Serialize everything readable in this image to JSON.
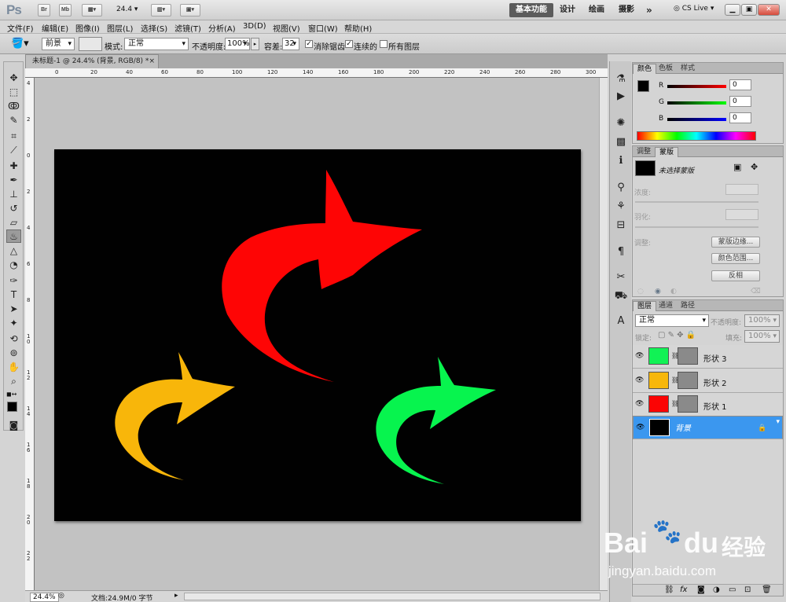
{
  "appbar": {
    "logo": "Ps",
    "btn_bridge": "Br",
    "btn_minibridge": "Mb",
    "zoom": "24.4",
    "workspaces": [
      "基本功能",
      "设计",
      "绘画",
      "摄影"
    ],
    "more": "»",
    "cslive": "CS Live"
  },
  "menu": [
    "文件(F)",
    "编辑(E)",
    "图像(I)",
    "图层(L)",
    "选择(S)",
    "滤镜(T)",
    "分析(A)",
    "3D(D)",
    "视图(V)",
    "窗口(W)",
    "帮助(H)"
  ],
  "options": {
    "fill_source": "前景",
    "mode_label": "模式:",
    "mode_value": "正常",
    "opacity_label": "不透明度:",
    "opacity_value": "100%",
    "tolerance_label": "容差:",
    "tolerance_value": "32",
    "antialias_label": "消除锯齿",
    "contiguous_label": "连续的",
    "alllayers_label": "所有图层"
  },
  "document": {
    "tab_title": "未标题-1 @ 24.4% (背景, RGB/8) *",
    "close": "×",
    "hruler": [
      "0",
      "20",
      "40",
      "60",
      "80",
      "100",
      "120",
      "140",
      "160",
      "180",
      "200",
      "220",
      "240",
      "260",
      "280",
      "300"
    ],
    "vruler": [
      "4",
      "2",
      "0",
      "2",
      "4",
      "6",
      "8",
      "1 0",
      "1 2",
      "1 4",
      "1 6",
      "1 8",
      "2 0",
      "2 2"
    ],
    "status_zoom": "24.4%",
    "status_doc": "文档:24.9M/0 字节"
  },
  "color_panel": {
    "tabs": [
      "颜色",
      "色板",
      "样式"
    ],
    "r_label": "R",
    "g_label": "G",
    "b_label": "B",
    "r": "0",
    "g": "0",
    "b": "0"
  },
  "masks_panel": {
    "tabs": [
      "调整",
      "蒙版"
    ],
    "no_mask": "未选择蒙版",
    "density_label": "浓度:",
    "feather_label": "羽化:",
    "refine_label": "调整:",
    "btn_edge": "蒙版边缘...",
    "btn_range": "颜色范围...",
    "btn_invert": "反相"
  },
  "layers_panel": {
    "tabs": [
      "图层",
      "通道",
      "路径"
    ],
    "blend": "正常",
    "opacity_label": "不透明度:",
    "opacity": "100%",
    "lock_label": "锁定:",
    "fill_label": "填充:",
    "fill": "100%",
    "layers": [
      {
        "name": "形状 3",
        "color": "#11f255"
      },
      {
        "name": "形状 2",
        "color": "#f7b70b"
      },
      {
        "name": "形状 1",
        "color": "#fb0404"
      },
      {
        "name": "背景",
        "color": "#000000"
      }
    ],
    "bottom_icons": [
      "link-icon",
      "fx-icon",
      "mask-icon",
      "adjustment-icon",
      "folder-icon",
      "new-layer-icon",
      "trash-icon"
    ]
  },
  "canvas": {
    "background": "#010101",
    "arrow_colors": [
      "#fe0505",
      "#f8b60a",
      "#07f44e"
    ]
  },
  "watermark": {
    "text1": "Bai",
    "text2": "du",
    "text3": "经验",
    "url": "jingyan.baidu.com"
  }
}
